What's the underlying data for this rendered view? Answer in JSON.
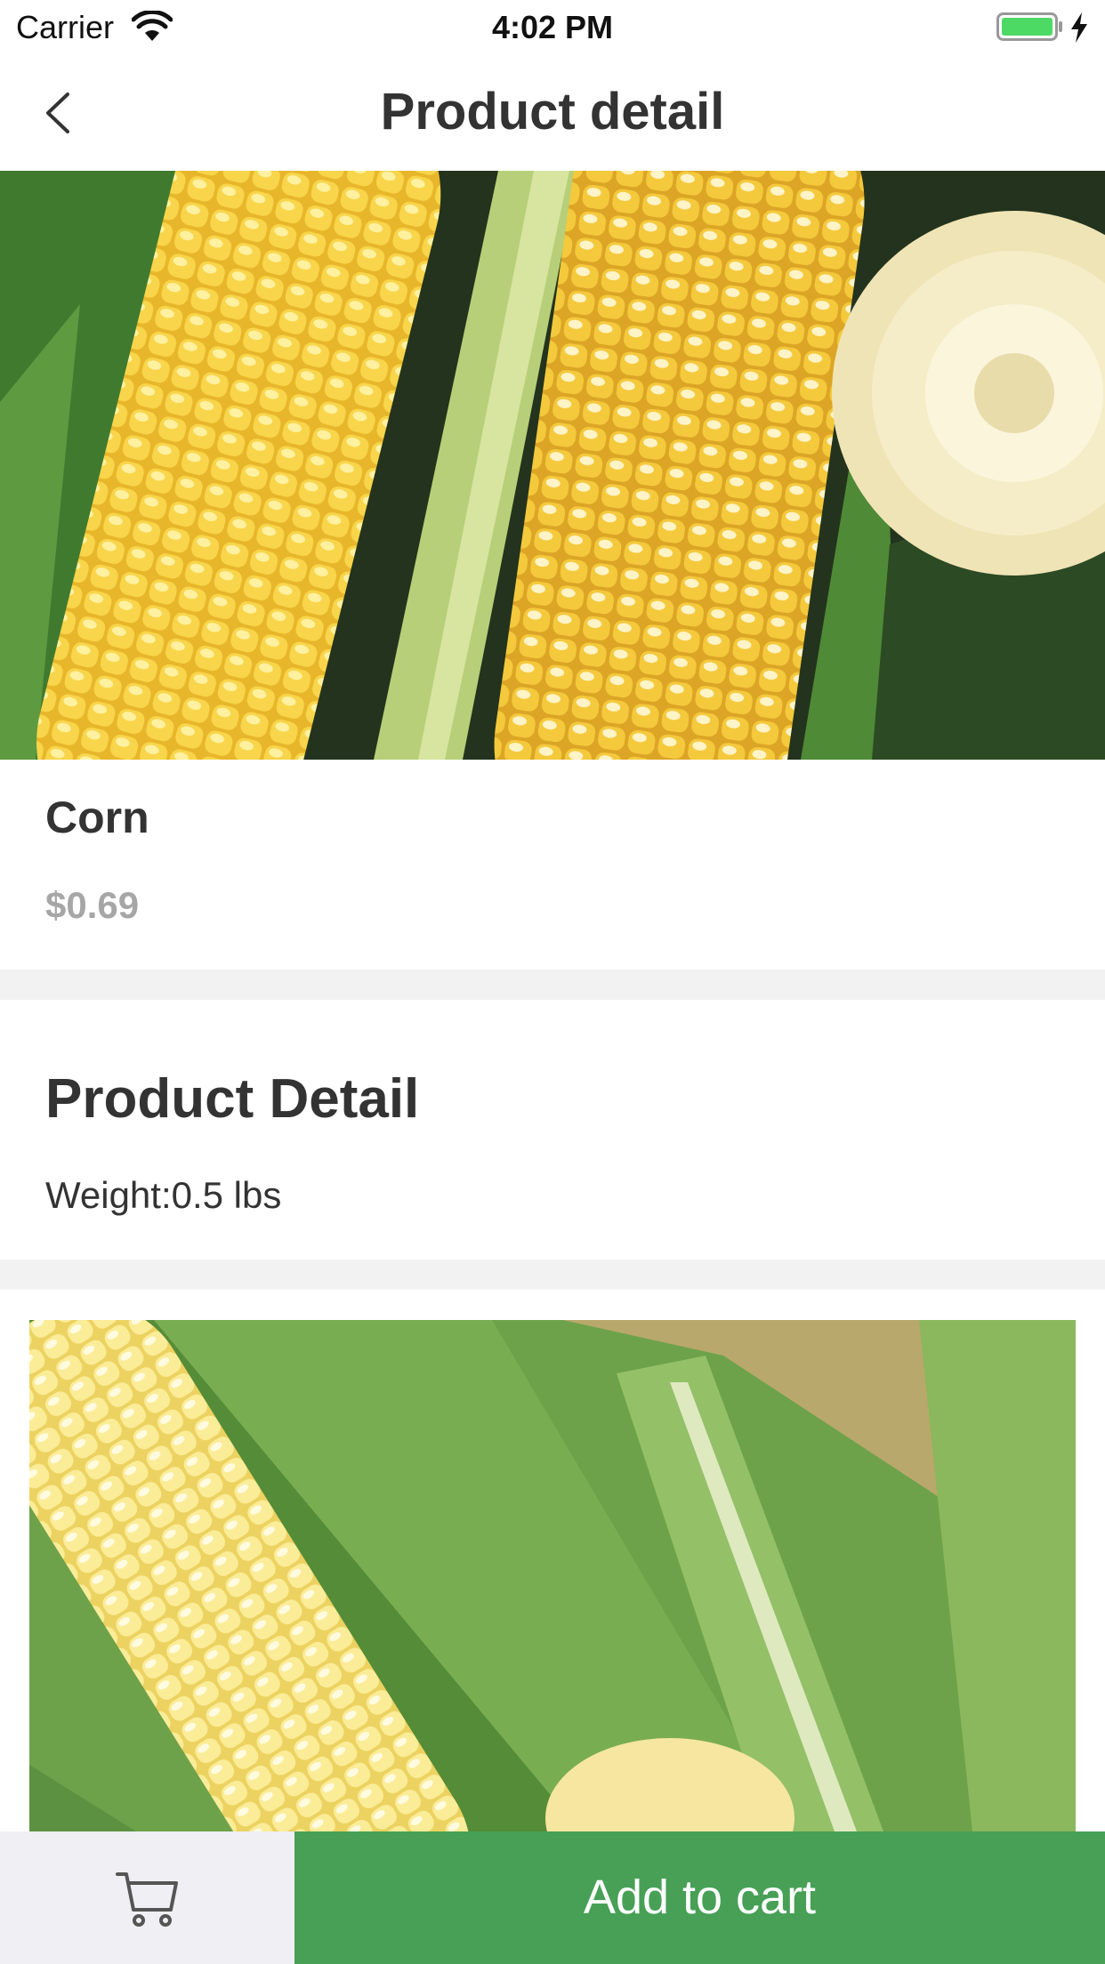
{
  "status_bar": {
    "carrier": "Carrier",
    "time": "4:02 PM",
    "battery_color": "#4cd964"
  },
  "nav": {
    "title": "Product detail",
    "back_icon": "chevron-left-icon"
  },
  "product": {
    "name": "Corn",
    "price": "$0.69",
    "hero_image": "corn-cobs-photo"
  },
  "detail": {
    "heading": "Product Detail",
    "weight": "Weight:0.5 lbs",
    "image": "corn-husk-photo"
  },
  "bottom_bar": {
    "cart_icon": "cart-icon",
    "add_to_cart_label": "Add to cart",
    "accent_color": "#47a056"
  }
}
